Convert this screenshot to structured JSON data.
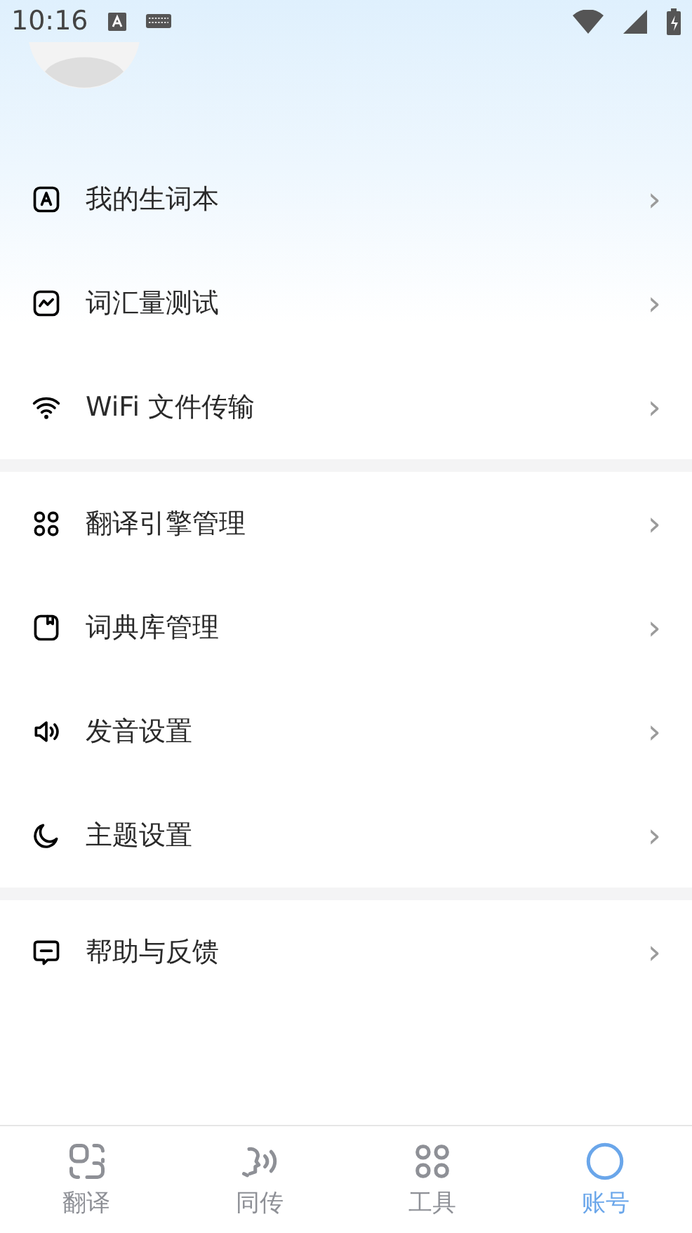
{
  "status_bar": {
    "time": "10:16"
  },
  "menu_groups": [
    {
      "items": [
        {
          "kind": "wordbook",
          "label": "我的生词本",
          "chevron": "›"
        },
        {
          "kind": "test",
          "label": "词汇量测试",
          "chevron": "›"
        },
        {
          "kind": "transfer",
          "label": "WiFi 文件传输",
          "chevron": "›"
        }
      ]
    },
    {
      "items": [
        {
          "kind": "engines",
          "label": "翻译引擎管理",
          "chevron": "›"
        },
        {
          "kind": "dictionary",
          "label": "词典库管理",
          "chevron": "›"
        },
        {
          "kind": "pronunciation",
          "label": "发音设置",
          "chevron": "›"
        },
        {
          "kind": "theme",
          "label": "主题设置",
          "chevron": "›"
        }
      ]
    },
    {
      "items": [
        {
          "kind": "help",
          "label": "帮助与反馈",
          "chevron": "›"
        }
      ]
    }
  ],
  "tabs": [
    {
      "kind": "translate",
      "label": "翻译",
      "selected": false
    },
    {
      "kind": "interpret",
      "label": "同传",
      "selected": false
    },
    {
      "kind": "tools",
      "label": "工具",
      "selected": false
    },
    {
      "kind": "account",
      "label": "账号",
      "selected": true
    }
  ]
}
